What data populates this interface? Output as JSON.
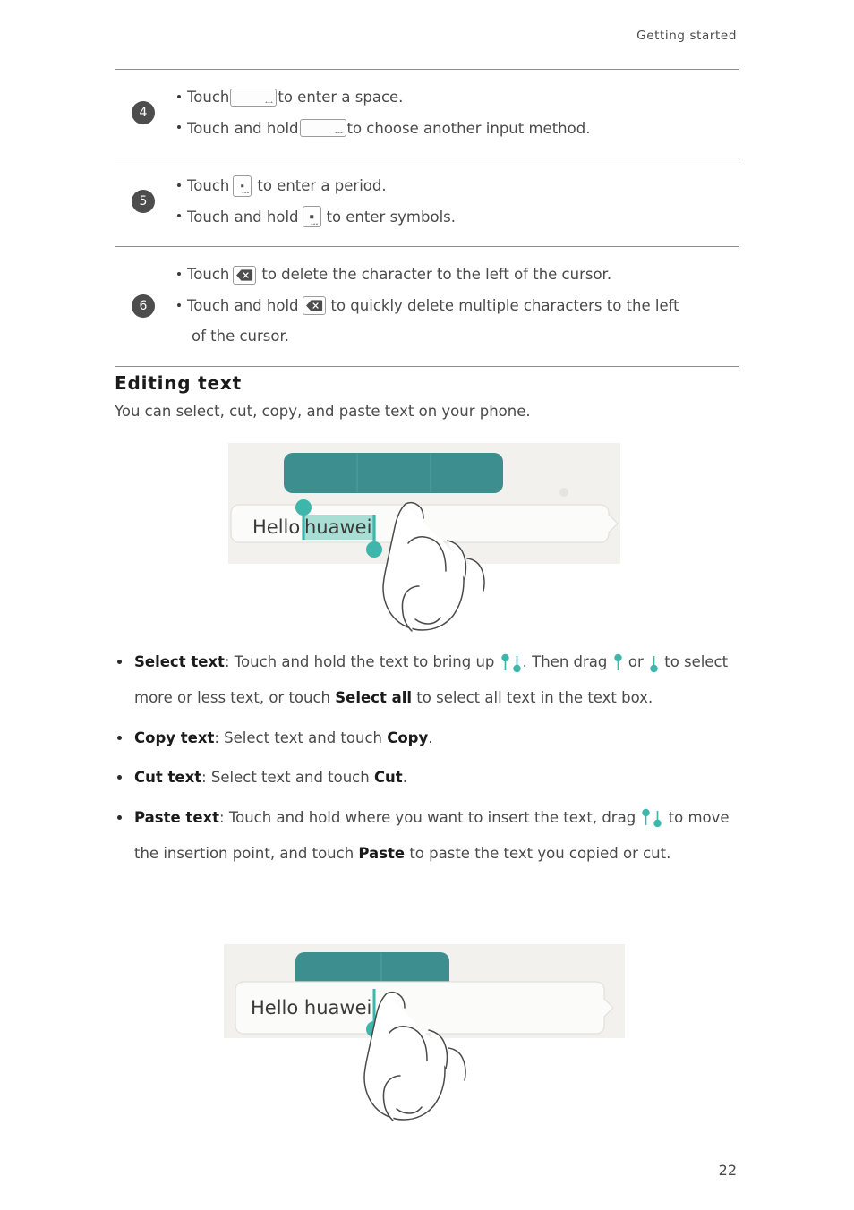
{
  "header": {
    "running_head": "Getting started"
  },
  "colors": {
    "teal": "#3d8e8e",
    "teal_handle": "#3fb6ab",
    "selection_highlight": "#a9ded5",
    "badge": "#4d4d4d",
    "rule": "#8d8d8d",
    "panel_bg": "#f2f1ee",
    "field_bg": "#fbfbfa"
  },
  "steps": [
    {
      "number": "4",
      "lines": [
        {
          "before": "Touch ",
          "icon": "space-key-icon",
          "after": "to enter a space."
        },
        {
          "before": "Touch and hold ",
          "icon": "space-key-icon",
          "after": "to choose another input method."
        }
      ]
    },
    {
      "number": "5",
      "lines": [
        {
          "before": "Touch ",
          "icon": "period-key-icon",
          "after": "to enter a period."
        },
        {
          "before": "Touch and hold ",
          "icon": "period-key-icon",
          "after": "to enter symbols."
        }
      ]
    },
    {
      "number": "6",
      "lines": [
        {
          "before": "Touch ",
          "icon": "backspace-key-icon",
          "after": "to delete the character to the left of the cursor."
        },
        {
          "before": "Touch and hold ",
          "icon": "backspace-key-icon",
          "after": "to quickly delete multiple characters to the left",
          "wrap": "of the cursor."
        }
      ]
    }
  ],
  "section": {
    "heading": "Editing  text",
    "intro": "You can select, cut, copy, and paste text on your phone."
  },
  "illustration_1": {
    "name": "select-text-illustration",
    "message_text": "Hello ",
    "selected_text": "huawei",
    "toolbar_segments": 3
  },
  "illustration_2": {
    "name": "paste-text-illustration",
    "message_text": "Hello huawei",
    "toolbar_segments": 2
  },
  "bullets": [
    {
      "id": "select-text",
      "term": "Select text",
      "p1": ": Touch and hold the text to bring up ",
      "icon1": "selection-handle-up-icon",
      "icon2": "selection-handle-down-icon",
      "p2": ". Then drag ",
      "icon3": "selection-handle-up-icon",
      "p3": " or ",
      "icon4": "selection-handle-down-icon",
      "p4": " to select more or less text, or touch ",
      "bold2": "Select all",
      "p5": " to select all text in the text box."
    },
    {
      "id": "copy-text",
      "term": "Copy text",
      "p1": ": Select text and touch ",
      "bold2": "Copy",
      "p5": "."
    },
    {
      "id": "cut-text",
      "term": "Cut text",
      "p1": ": Select text and touch ",
      "bold2": "Cut",
      "p5": "."
    },
    {
      "id": "paste-text",
      "term": "Paste text",
      "p1": ": Touch and hold where you want to insert the text, drag ",
      "icon1": "selection-handle-up-icon",
      "icon2": "selection-handle-down-icon",
      "p4": " to move the insertion point, and touch ",
      "bold2": "Paste",
      "p5": " to paste the text you copied or cut."
    }
  ],
  "footer": {
    "page_number": "22"
  }
}
